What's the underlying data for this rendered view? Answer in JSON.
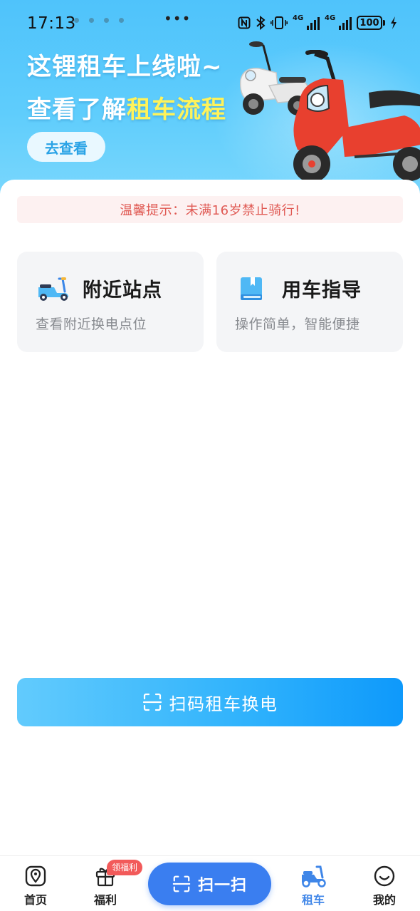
{
  "status_bar": {
    "time": "17:13",
    "more": "•••",
    "signal1_label": "4G",
    "signal2_label": "4G",
    "battery": "100",
    "icons": [
      "nfc-icon",
      "bluetooth-icon",
      "vibrate-icon",
      "signal-icon",
      "signal-icon",
      "battery-icon",
      "charging-icon"
    ]
  },
  "banner": {
    "line1": "这锂租车上线啦~",
    "line2_prefix": "查看了解",
    "line2_highlight": "租车流程",
    "cta": "去查看",
    "highlight_color": "#fff35a"
  },
  "notice": {
    "text": "温馨提示：未满16岁禁止骑行!"
  },
  "cards": [
    {
      "title": "附近站点",
      "subtitle": "查看附近换电点位",
      "icon": "scooter-icon"
    },
    {
      "title": "用车指导",
      "subtitle": "操作简单，智能便捷",
      "icon": "book-icon"
    }
  ],
  "scan_rent_button": {
    "label": "扫码租车换电",
    "icon": "scan-icon"
  },
  "tabbar": {
    "home": "首页",
    "welfare": "福利",
    "welfare_badge": "领福利",
    "scan": "扫一扫",
    "rent": "租车",
    "mine": "我的",
    "active": "租车",
    "accent": "#3a7ef0"
  }
}
